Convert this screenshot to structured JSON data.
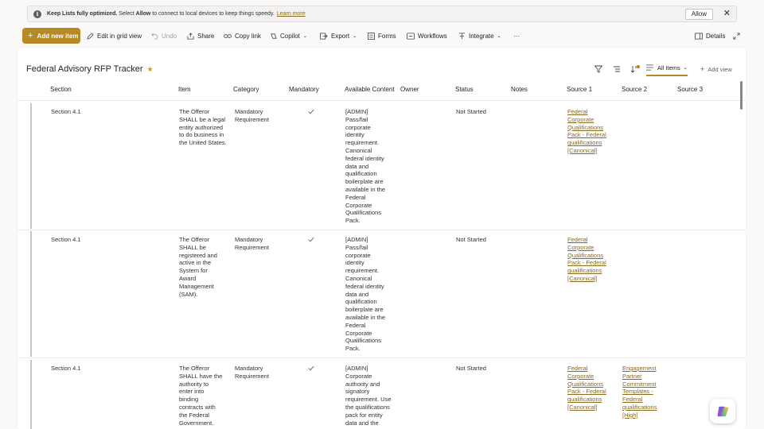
{
  "infobar": {
    "prefix": "Keep Lists fully optimized.",
    "msg_a": " Select ",
    "msg_bold": "Allow",
    "msg_b": " to connect to local devices to keep things speedy.",
    "learn_more": "Learn more",
    "allow": "Allow"
  },
  "toolbar": {
    "add_new": "Add new item",
    "edit_grid": "Edit in grid view",
    "undo": "Undo",
    "share": "Share",
    "copy_link": "Copy link",
    "copilot": "Copilot",
    "export": "Export",
    "forms": "Forms",
    "workflows": "Workflows",
    "integrate": "Integrate",
    "more": "···",
    "details": "Details"
  },
  "list": {
    "title": "Federal Advisory RFP Tracker",
    "view_name": "All Items",
    "add_view": "Add view"
  },
  "columns": [
    "Section",
    "Item",
    "Category",
    "Mandatory",
    "Available Content",
    "Owner",
    "Status",
    "Notes",
    "Source 1",
    "Source 2",
    "Source 3"
  ],
  "rows": [
    {
      "section": "Section 4.1",
      "item": [
        "The Offeror",
        "SHALL be a legal",
        "entity authorized",
        "to do business in",
        "the United States."
      ],
      "category": [
        "Mandatory",
        "Requirement"
      ],
      "mandatory": true,
      "content": [
        "[ADMIN]",
        "Pass/fail",
        "corporate",
        "identity",
        "requirement.",
        "Canonical",
        "federal identity",
        "data and",
        "qualification",
        "boilerplate are",
        "available in the",
        "Federal",
        "Corporate",
        "Qualifications",
        "Pack."
      ],
      "status": "Not Started",
      "source1": [
        "Federal",
        "Corporate",
        "Qualifications",
        "Pack - Federal",
        "qualifications",
        "[Canonical]"
      ],
      "source2": []
    },
    {
      "section": "Section 4.1",
      "item": [
        "The Offeror",
        "SHALL be",
        "registered and",
        "active in the",
        "System for",
        "Award",
        "Management",
        "(SAM)."
      ],
      "category": [
        "Mandatory",
        "Requirement"
      ],
      "mandatory": true,
      "content": [
        "[ADMIN]",
        "Pass/fail",
        "corporate",
        "identity",
        "requirement.",
        "Canonical",
        "federal identity",
        "data and",
        "qualification",
        "boilerplate are",
        "available in the",
        "Federal",
        "Corporate",
        "Qualifications",
        "Pack."
      ],
      "status": "Not Started",
      "source1": [
        "Federal",
        "Corporate",
        "Qualifications",
        "Pack - Federal",
        "qualifications",
        "[Canonical]"
      ],
      "source2": []
    },
    {
      "section": "Section 4.1",
      "item": [
        "The Offeror",
        "SHALL have the",
        "authority to",
        "enter into",
        "binding",
        "contracts with",
        "the Federal",
        "Government."
      ],
      "category": [
        "Mandatory",
        "Requirement"
      ],
      "mandatory": true,
      "content": [
        "[ADMIN]",
        "Corporate",
        "authority and",
        "signatory",
        "requirement. Use",
        "the qualifications",
        "pack for entity",
        "data and the"
      ],
      "status": "Not Started",
      "source1": [
        "Federal",
        "Corporate",
        "Qualifications",
        "Pack - Federal",
        "qualifications",
        "[Canonical]"
      ],
      "source2": [
        "Engagement",
        "Partner",
        "Commitment",
        "Templates -",
        "Federal",
        "qualifications",
        "[High]"
      ]
    }
  ],
  "colors": {
    "accent": "#b58a24",
    "link": "#8a6a1f"
  }
}
